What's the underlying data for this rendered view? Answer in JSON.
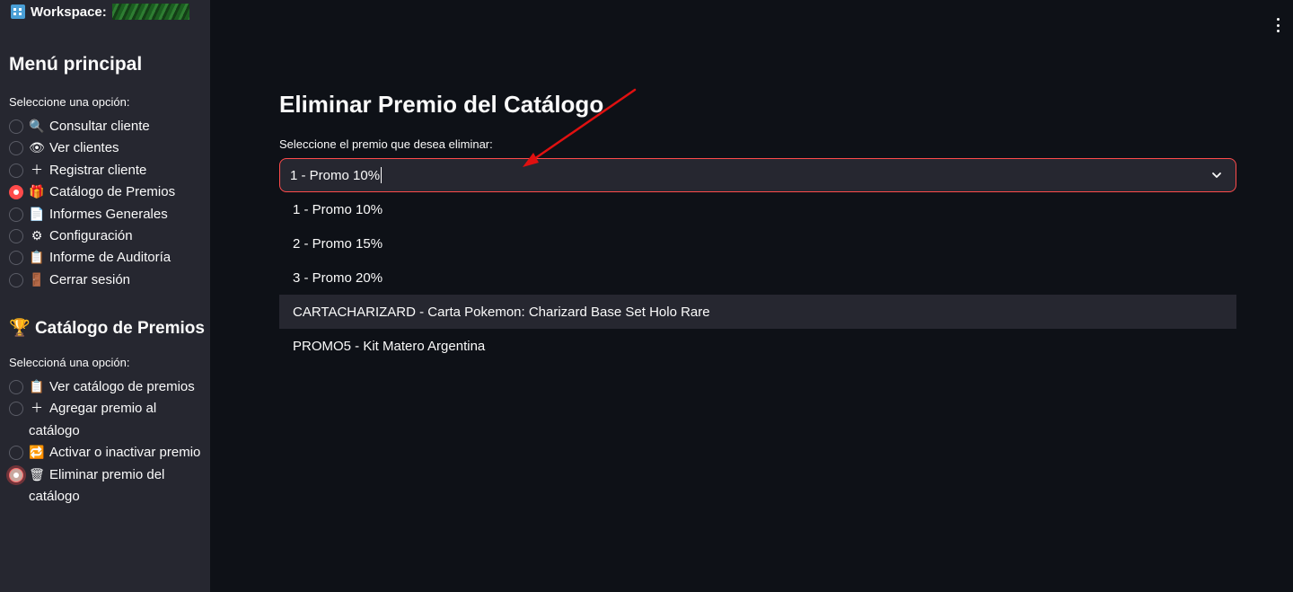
{
  "sidebar": {
    "workspace_label": "Workspace:",
    "menu_title": "Menú principal",
    "menu_prompt": "Seleccione una opción:",
    "menu_items": [
      {
        "icon": "magnifier-icon",
        "glyph": "🔍",
        "label": "Consultar cliente",
        "selected": false
      },
      {
        "icon": "eye-icon",
        "glyph": "👁",
        "label": "Ver clientes",
        "selected": false
      },
      {
        "icon": "plus-icon",
        "glyph": "＋",
        "label": "Registrar cliente",
        "selected": false
      },
      {
        "icon": "gift-icon",
        "glyph": "🎁",
        "label": "Catálogo de Premios",
        "selected": true
      },
      {
        "icon": "document-icon",
        "glyph": "📄",
        "label": "Informes Generales",
        "selected": false
      },
      {
        "icon": "gear-icon",
        "glyph": "⚙",
        "label": "Configuración",
        "selected": false
      },
      {
        "icon": "clipboard-icon",
        "glyph": "📋",
        "label": "Informe de Auditoría",
        "selected": false
      },
      {
        "icon": "door-icon",
        "glyph": "🚪",
        "label": "Cerrar sesión",
        "selected": false
      }
    ],
    "catalog_title": "Catálogo de Premios",
    "catalog_title_icon": "trophy-icon",
    "catalog_prompt": "Seleccioná una opción:",
    "catalog_items": [
      {
        "icon": "clipboard-icon",
        "glyph": "📋",
        "label": "Ver catálogo de premios",
        "selected": false
      },
      {
        "icon": "plus-icon",
        "glyph": "＋",
        "label": "Agregar premio al catálogo",
        "selected": false
      },
      {
        "icon": "refresh-icon",
        "glyph": "🔁",
        "label": "Activar o inactivar premio",
        "selected": false
      },
      {
        "icon": "trash-icon",
        "glyph": "🗑",
        "label": "Eliminar premio del catálogo",
        "selected": true
      }
    ]
  },
  "main": {
    "title": "Eliminar Premio del Catálogo",
    "select_label": "Seleccione el premio que desea eliminar:",
    "select_value": "1 - Promo 10%",
    "options": [
      "1 - Promo 10%",
      "2 - Promo 15%",
      "3 - Promo 20%",
      "CARTACHARIZARD - Carta Pokemon: Charizard Base Set Holo Rare",
      "PROMO5 - Kit Matero Argentina"
    ],
    "highlighted_option_index": 3
  },
  "colors": {
    "accent": "#ff4b4b",
    "sidebar_bg": "#262730",
    "main_bg": "#0e1117",
    "annotation_arrow": "#e01010"
  }
}
